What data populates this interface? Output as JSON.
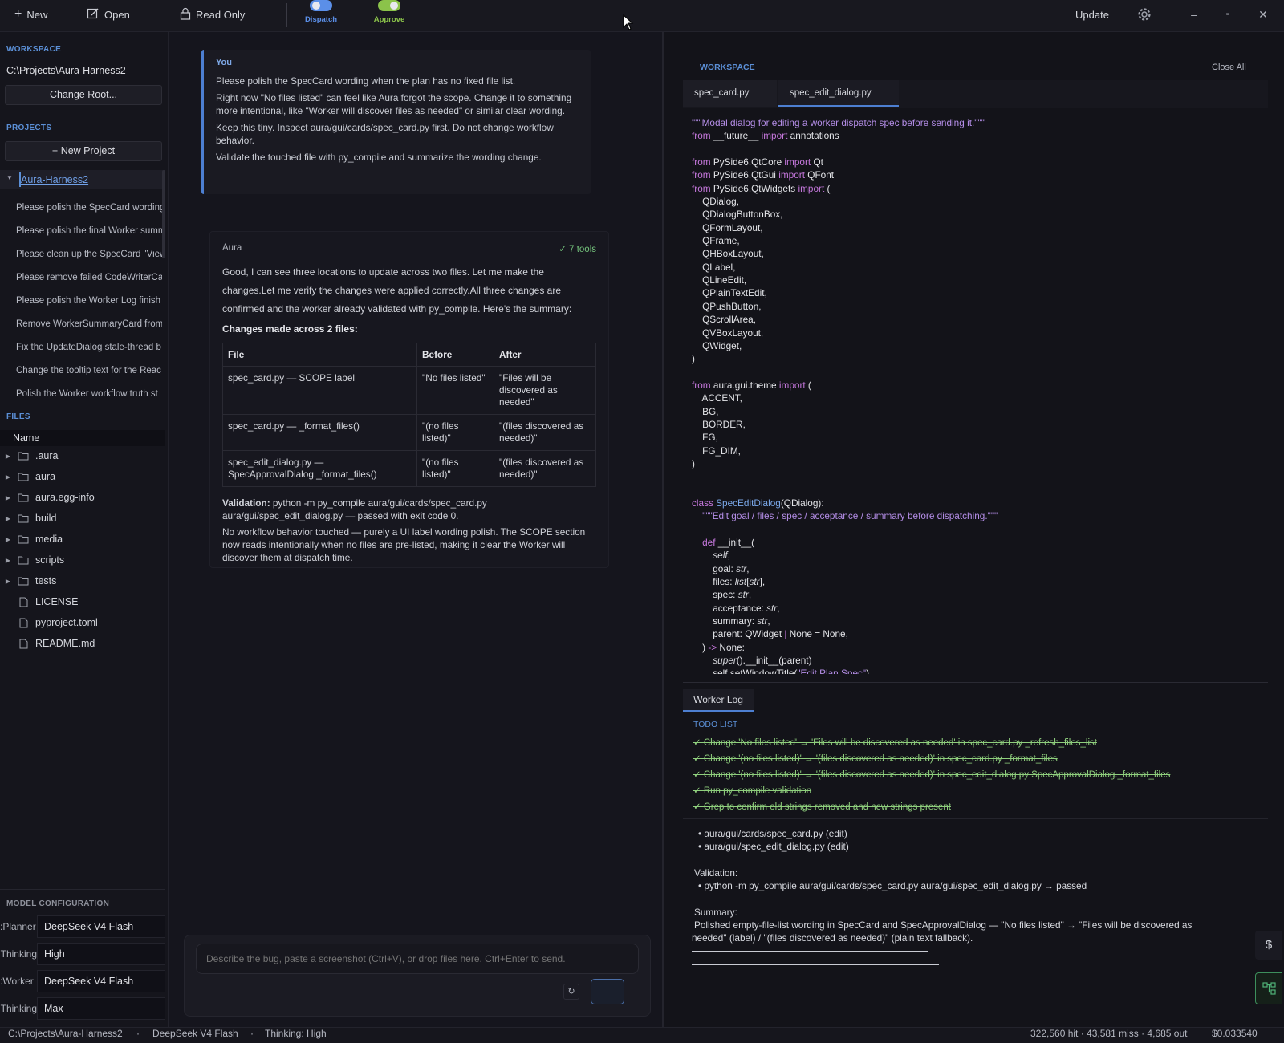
{
  "toolbar": {
    "new_label": "New",
    "open_label": "Open",
    "readonly_label": "Read Only",
    "dispatch_label": "Dispatch",
    "approve_label": "Approve",
    "update_label": "Update",
    "colors": {
      "dispatch": "#5b8fe8",
      "approve": "#8bc34a"
    }
  },
  "sidebar": {
    "workspace_title": "WORKSPACE",
    "workspace_path": "C:\\Projects\\Aura-Harness2",
    "change_root_label": "Change Root...",
    "projects_title": "PROJECTS",
    "new_project_label": "New Project",
    "project_name": "Aura-Harness2",
    "project_items": [
      "Please polish the SpecCard wording",
      "Please polish the final Worker summ",
      "Please clean up the SpecCard \"View",
      "Please remove failed CodeWriterCa",
      "Please polish the Worker Log finish",
      "Remove WorkerSummaryCard from",
      "Fix the UpdateDialog stale-thread b",
      "Change the tooltip text for the Reac",
      "Polish the Worker workflow truth st"
    ],
    "files_title": "FILES",
    "files_header": "Name",
    "files": [
      {
        "name": ".aura",
        "type": "folder"
      },
      {
        "name": "aura",
        "type": "folder"
      },
      {
        "name": "aura.egg-info",
        "type": "folder"
      },
      {
        "name": "build",
        "type": "folder"
      },
      {
        "name": "media",
        "type": "folder"
      },
      {
        "name": "scripts",
        "type": "folder"
      },
      {
        "name": "tests",
        "type": "folder"
      },
      {
        "name": "LICENSE",
        "type": "file"
      },
      {
        "name": "pyproject.toml",
        "type": "file"
      },
      {
        "name": "README.md",
        "type": "file"
      }
    ],
    "model_config_title": "MODEL CONFIGURATION",
    "model_config": [
      {
        "label": "Planner:",
        "value": "DeepSeek V4 Flash"
      },
      {
        "label": "Thinking:",
        "value": "High"
      },
      {
        "label": "Worker:",
        "value": "DeepSeek V4 Flash"
      },
      {
        "label": "Thinking:",
        "value": "Max"
      }
    ]
  },
  "chat": {
    "user_label": "You",
    "user_lines": [
      "Please polish the SpecCard wording when the plan has no fixed file list.",
      "Right now \"No files listed\" can feel like Aura forgot the scope. Change it to something more intentional, like \"Worker will discover files as needed\" or similar clear wording.",
      "Keep this tiny. Inspect aura/gui/cards/spec_card.py first. Do not change workflow behavior.",
      "Validate the touched file with py_compile and summarize the wording change."
    ],
    "aura_label": "Aura",
    "tools_badge": "✓ 7 tools",
    "aura_intro": "Good, I can see three locations to update across two files. Let me make the changes.Let me verify the changes were applied correctly.All three changes are confirmed and the worker already validated with py_compile. Here's the summary:",
    "changes_heading": "Changes made across 2 files:",
    "table_headers": [
      "File",
      "Before",
      "After"
    ],
    "table_rows": [
      [
        "spec_card.py — SCOPE label",
        "\"No files listed\"",
        "\"Files will be discovered as needed\""
      ],
      [
        "spec_card.py — _format_files()",
        "\"(no files listed)\"",
        "\"(files discovered as needed)\""
      ],
      [
        "spec_edit_dialog.py — SpecApprovalDialog._format_files()",
        "\"(no files listed)\"",
        "\"(files discovered as needed)\""
      ]
    ],
    "validation_label": "Validation:",
    "validation_text": " python -m py_compile aura/gui/cards/spec_card.py aura/gui/spec_edit_dialog.py — passed with exit code 0.",
    "closing_text": "No workflow behavior touched — purely a UI label wording polish. The SCOPE section now reads intentionally when no files are pre-listed, making it clear the Worker will discover them at dispatch time.",
    "composer_placeholder": "Describe the bug, paste a screenshot (Ctrl+V), or drop files here. Ctrl+Enter to send."
  },
  "editor": {
    "workspace_title": "WORKSPACE",
    "close_all_label": "Close All",
    "tabs": [
      "spec_card.py",
      "spec_edit_dialog.py"
    ],
    "active_tab": "spec_edit_dialog.py"
  },
  "worker_log": {
    "tab_label": "Worker Log",
    "todo_title": "TODO LIST",
    "todos": [
      "✓ Change 'No files listed' → 'Files will be discovered as needed' in spec_card.py _refresh_files_list",
      "✓ Change '(no files listed)' → '(files discovered as needed)' in spec_card.py _format_files",
      "✓ Change '(no files listed)' → '(files discovered as needed)' in spec_edit_dialog.py SpecApprovalDialog._format_files",
      "✓ Run py_compile validation",
      "✓ Grep to confirm old strings removed and new strings present"
    ],
    "edited_files": [
      "• aura/gui/cards/spec_card.py   (edit)",
      "• aura/gui/spec_edit_dialog.py   (edit)"
    ],
    "validation_title": "Validation:",
    "validation_line": "• python -m py_compile aura/gui/cards/spec_card.py aura/gui/spec_edit_dialog.py  →  passed",
    "summary_title": "Summary:",
    "summary_line1": "Polished empty-file-list wording in SpecCard and SpecApprovalDialog — \"No files listed\" → \"Files will be discovered as",
    "summary_line2": "needed\" (label) / \"(files discovered as needed)\" (plain text fallback)."
  },
  "statusbar": {
    "path": "C:\\Projects\\Aura-Harness2",
    "model": "DeepSeek V4 Flash",
    "thinking": "Thinking: High",
    "tokens": "322,560 hit · 43,581 miss · 4,685 out",
    "cost": "$0.033540"
  }
}
